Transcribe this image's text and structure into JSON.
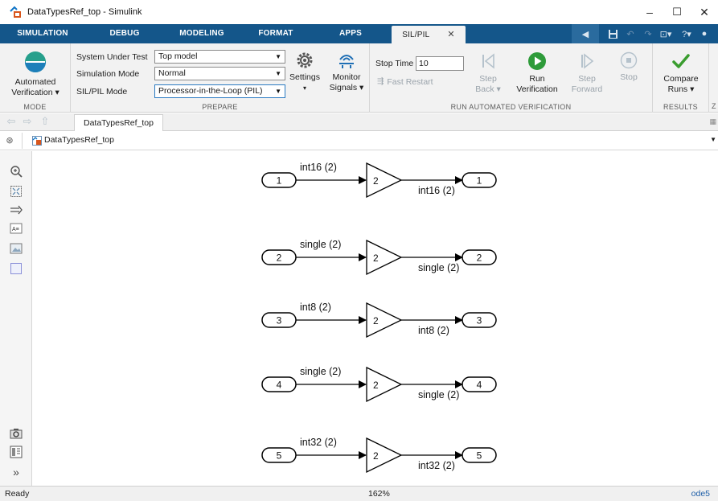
{
  "window": {
    "title": "DataTypesRef_top - Simulink",
    "controls": {
      "minimize": "–",
      "maximize": "☐",
      "close": "✕"
    }
  },
  "tabs": [
    {
      "label": "SIMULATION"
    },
    {
      "label": "DEBUG"
    },
    {
      "label": "MODELING"
    },
    {
      "label": "FORMAT"
    },
    {
      "label": "APPS"
    },
    {
      "label": "SIL/PIL",
      "active": true,
      "close": "✕"
    }
  ],
  "ribbon": {
    "mode": {
      "button_line1": "Automated",
      "button_line2": "Verification ▾",
      "section_label": "MODE"
    },
    "prepare": {
      "system_under_test_label": "System Under Test",
      "system_under_test_value": "Top model",
      "simulation_mode_label": "Simulation Mode",
      "simulation_mode_value": "Normal",
      "sil_pil_mode_label": "SIL/PIL Mode",
      "sil_pil_mode_value": "Processor-in-the-Loop (PIL)",
      "settings_label": "Settings",
      "settings_caret": "▾",
      "monitor_line1": "Monitor",
      "monitor_line2": "Signals ▾",
      "section_label": "PREPARE"
    },
    "run": {
      "stop_time_label": "Stop Time",
      "stop_time_value": "10",
      "fast_restart_label": "Fast Restart",
      "step_back_line1": "Step",
      "step_back_line2": "Back ▾",
      "run_line1": "Run",
      "run_line2": "Verification",
      "step_forward_line1": "Step",
      "step_forward_line2": "Forward",
      "stop_label": "Stop",
      "section_label": "RUN AUTOMATED VERIFICATION"
    },
    "results": {
      "compare_line1": "Compare",
      "compare_line2": "Runs ▾",
      "section_label": "RESULTS"
    },
    "overflow_label": "Z"
  },
  "navigation": {
    "doc_tab": "DataTypesRef_top",
    "breadcrumb": "DataTypesRef_top"
  },
  "diagram": {
    "rows": [
      {
        "inport": "1",
        "in_type": "int16 (2)",
        "gain": "2",
        "out_type": "int16 (2)",
        "outport": "1"
      },
      {
        "inport": "2",
        "in_type": "single (2)",
        "gain": "2",
        "out_type": "single (2)",
        "outport": "2"
      },
      {
        "inport": "3",
        "in_type": "int8 (2)",
        "gain": "2",
        "out_type": "int8 (2)",
        "outport": "3"
      },
      {
        "inport": "4",
        "in_type": "single (2)",
        "gain": "2",
        "out_type": "single (2)",
        "outport": "4"
      },
      {
        "inport": "5",
        "in_type": "int32 (2)",
        "gain": "2",
        "out_type": "int32 (2)",
        "outport": "5"
      }
    ]
  },
  "status": {
    "state": "Ready",
    "zoom": "162%",
    "solver": "ode5"
  },
  "colors": {
    "tab_strip": "#14568a",
    "ribbon_bg": "#f2f2f2",
    "run_green": "#2e9b3a",
    "mode_teal": "#27a08c",
    "disabled": "#9aa3ab",
    "link_blue": "#1f5fa8"
  },
  "icons": {
    "app": "simulink-logo-icon",
    "mode": "automated-verification-icon",
    "settings": "gear-icon",
    "monitor": "monitor-signals-icon",
    "fast_restart": "fast-restart-icon",
    "step_back": "step-back-icon",
    "run": "play-icon",
    "step_forward": "step-forward-icon",
    "stop": "stop-icon",
    "compare": "checkmark-icon",
    "nav_back": "back-arrow-icon",
    "nav_forward": "forward-arrow-icon",
    "nav_up": "up-arrow-icon",
    "crumb_toggle": "hide-show-browser-icon",
    "zoom": "zoom-icon",
    "fit": "fit-to-view-icon",
    "arrow_sig": "signal-line-icon",
    "annotation": "annotation-icon",
    "image": "image-icon",
    "area": "area-box-icon",
    "camera": "camera-icon",
    "property": "property-inspector-icon",
    "expand": "expand-palette-icon"
  }
}
